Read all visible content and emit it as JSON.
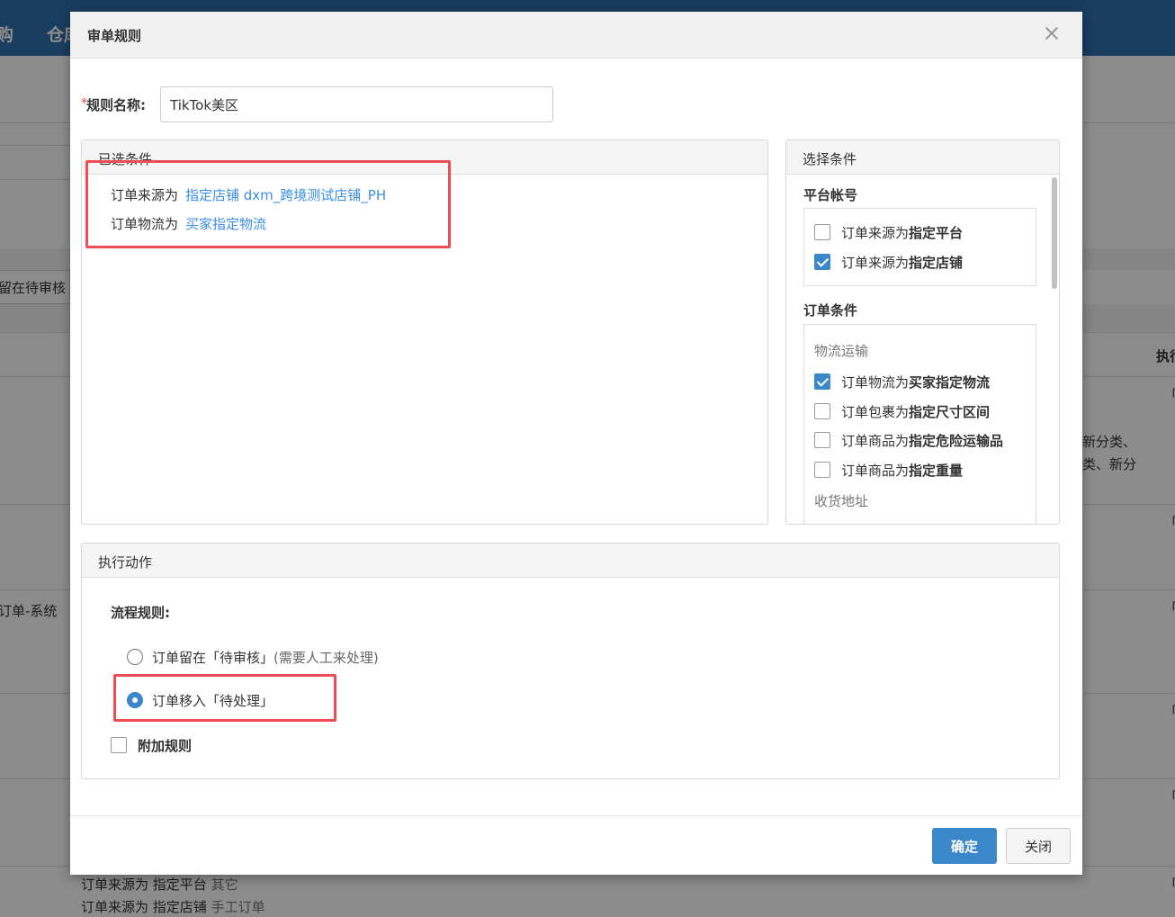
{
  "background": {
    "nav": [
      "购",
      "仓库"
    ],
    "left_texts": [
      "留在待审核",
      "订单-系统"
    ],
    "right_header": "执行",
    "right_marks": [
      "「行",
      "「行",
      "「行",
      "「行",
      "「行",
      "「行"
    ],
    "right_texts": [
      "新分类、",
      "类、新分"
    ],
    "bottom_lines": [
      {
        "label": "订单来源为 指定平台",
        "value": "其它"
      },
      {
        "label": "订单来源为 指定店铺",
        "value": "手工订单"
      }
    ]
  },
  "modal": {
    "title": "审单规则",
    "name_field": {
      "required_mark": "*",
      "label": "规则名称:",
      "value": "TikTok美区"
    },
    "selected_panel": {
      "title": "已选条件",
      "items": [
        {
          "prefix": "订单来源为",
          "value": "指定店铺  dxm_跨境测试店铺_PH"
        },
        {
          "prefix": "订单物流为",
          "value": "买家指定物流"
        }
      ]
    },
    "choose_panel": {
      "title": "选择条件",
      "groups": [
        {
          "title": "平台帐号",
          "items": [
            {
              "prefix": "订单来源为",
              "bold": "指定平台",
              "checked": false
            },
            {
              "prefix": "订单来源为",
              "bold": "指定店铺",
              "checked": true
            }
          ]
        },
        {
          "title": "订单条件",
          "subgroups": [
            {
              "title": "物流运输",
              "items": [
                {
                  "prefix": "订单物流为",
                  "bold": "买家指定物流",
                  "checked": true
                },
                {
                  "prefix": "订单包裹为",
                  "bold": "指定尺寸区间",
                  "checked": false
                },
                {
                  "prefix": "订单商品为",
                  "bold": "指定危险运输品",
                  "checked": false
                },
                {
                  "prefix": "订单商品为",
                  "bold": "指定重量",
                  "checked": false
                }
              ]
            },
            {
              "title": "收货地址",
              "items": []
            }
          ]
        }
      ]
    },
    "action_panel": {
      "title": "执行动作",
      "rule_label": "流程规则:",
      "options": [
        {
          "label": "订单留在「待审核」",
          "note": "(需要人工来处理)",
          "selected": false
        },
        {
          "label": "订单移入「待处理」",
          "note": "",
          "selected": true
        }
      ],
      "extra": {
        "label": "附加规则",
        "checked": false
      }
    },
    "buttons": {
      "confirm": "确定",
      "close": "关闭"
    }
  },
  "colors": {
    "accent": "#3a87c9",
    "link": "#3a8ee6",
    "annotation": "#ee4d55",
    "nav_bg": "#2f6fab"
  }
}
